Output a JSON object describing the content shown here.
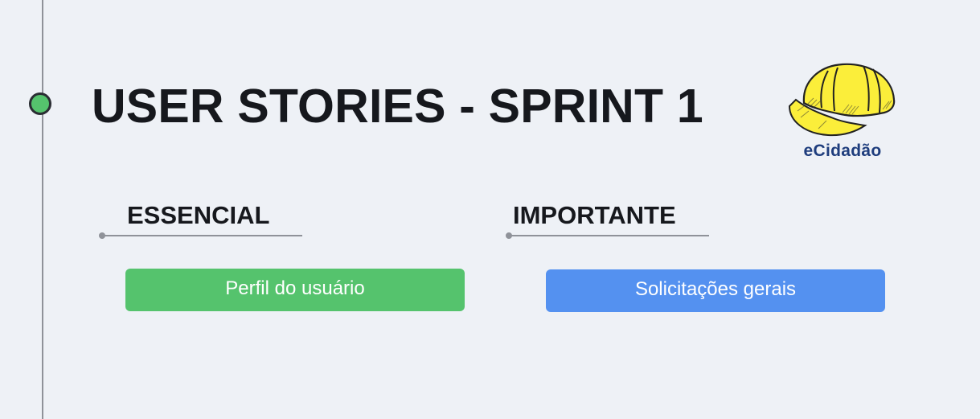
{
  "title": "USER STORIES - SPRINT 1",
  "logo": {
    "text": "eCidadão"
  },
  "sections": [
    {
      "heading": "ESSENCIAL",
      "stories": [
        {
          "label": "Perfil do usuário",
          "color": "#55c36d"
        }
      ]
    },
    {
      "heading": "IMPORTANTE",
      "stories": [
        {
          "label": "Solicitações gerais",
          "color": "#5491f0"
        }
      ]
    }
  ],
  "colors": {
    "timeline_dot": "#55c36d",
    "essential": "#55c36d",
    "important": "#5491f0",
    "helmet": "#fbee3a"
  }
}
